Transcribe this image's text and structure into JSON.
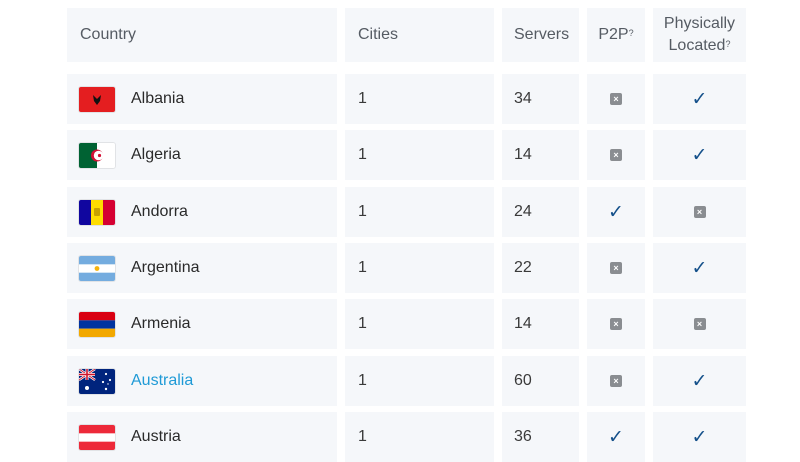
{
  "header": {
    "country": "Country",
    "cities": "Cities",
    "servers": "Servers",
    "p2p": "P2P",
    "p2p_sup": "?",
    "physically_line1": "Physically",
    "physically_line2": "Located",
    "physically_sup": "?"
  },
  "rows": [
    {
      "country": "Albania",
      "cities": "1",
      "servers": "34",
      "p2p": "no",
      "physical": "yes",
      "link": false,
      "flag": "albania-flag-icon"
    },
    {
      "country": "Algeria",
      "cities": "1",
      "servers": "14",
      "p2p": "no",
      "physical": "yes",
      "link": false,
      "flag": "algeria-flag-icon"
    },
    {
      "country": "Andorra",
      "cities": "1",
      "servers": "24",
      "p2p": "yes",
      "physical": "no",
      "link": false,
      "flag": "andorra-flag-icon"
    },
    {
      "country": "Argentina",
      "cities": "1",
      "servers": "22",
      "p2p": "no",
      "physical": "yes",
      "link": false,
      "flag": "argentina-flag-icon"
    },
    {
      "country": "Armenia",
      "cities": "1",
      "servers": "14",
      "p2p": "no",
      "physical": "no",
      "link": false,
      "flag": "armenia-flag-icon"
    },
    {
      "country": "Australia",
      "cities": "1",
      "servers": "60",
      "p2p": "no",
      "physical": "yes",
      "link": true,
      "flag": "australia-flag-icon"
    },
    {
      "country": "Austria",
      "cities": "1",
      "servers": "36",
      "p2p": "yes",
      "physical": "yes",
      "link": false,
      "flag": "austria-flag-icon"
    }
  ],
  "icons": {
    "yes": "check-icon",
    "no": "x-box-icon"
  },
  "colors": {
    "cell_bg": "#f5f7fa",
    "check": "#14508a",
    "link": "#1f9ad6",
    "x_box": "#8a8d91"
  }
}
